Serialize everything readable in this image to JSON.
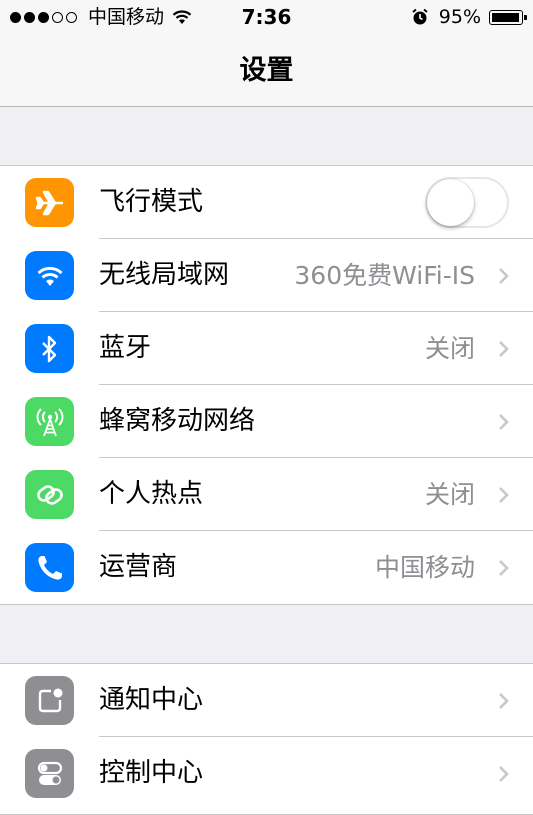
{
  "status_bar": {
    "signal_dots": [
      true,
      true,
      true,
      false,
      false
    ],
    "carrier": "中国移动",
    "time": "7:36",
    "battery_percent": "95%",
    "battery_level": 0.95,
    "icons": [
      "wifi-icon",
      "alarm-icon",
      "battery-icon"
    ]
  },
  "nav": {
    "title": "设置"
  },
  "colors": {
    "orange": "#ff9500",
    "blue": "#007aff",
    "green": "#4cd964",
    "gray": "#8e8e93"
  },
  "settings": {
    "group1": [
      {
        "label": "飞行模式",
        "icon": "airplane-icon",
        "icon_color": "#ff9500",
        "control": "switch",
        "on": false
      },
      {
        "label": "无线局域网",
        "icon": "wifi-icon",
        "icon_color": "#007aff",
        "value": "360免费WiFi-IS"
      },
      {
        "label": "蓝牙",
        "icon": "bluetooth-icon",
        "icon_color": "#007aff",
        "value": "关闭"
      },
      {
        "label": "蜂窝移动网络",
        "icon": "cellular-icon",
        "icon_color": "#4cd964",
        "value": ""
      },
      {
        "label": "个人热点",
        "icon": "hotspot-icon",
        "icon_color": "#4cd964",
        "value": "关闭"
      },
      {
        "label": "运营商",
        "icon": "phone-icon",
        "icon_color": "#007aff",
        "value": "中国移动"
      }
    ],
    "group2": [
      {
        "label": "通知中心",
        "icon": "notification-center-icon",
        "icon_color": "#8e8e93"
      },
      {
        "label": "控制中心",
        "icon": "control-center-icon",
        "icon_color": "#8e8e93"
      }
    ]
  }
}
